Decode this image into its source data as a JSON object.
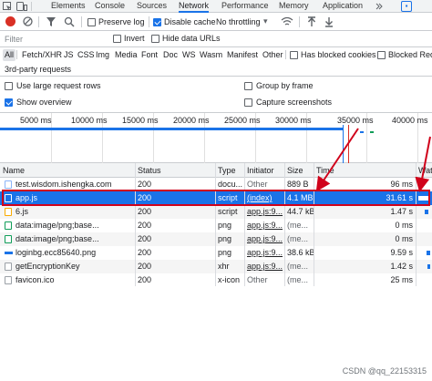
{
  "tabs": [
    "Elements",
    "Console",
    "Sources",
    "Network",
    "Performance",
    "Memory",
    "Application"
  ],
  "active_tab": "Network",
  "toolbar": {
    "preserve_log": "Preserve log",
    "disable_cache": "Disable cache",
    "throttling": "No throttling"
  },
  "filter": {
    "placeholder": "Filter",
    "invert": "Invert",
    "hide_data_urls": "Hide data URLs"
  },
  "types": [
    "All",
    "Fetch/XHR",
    "JS",
    "CSS",
    "Img",
    "Media",
    "Font",
    "Doc",
    "WS",
    "Wasm",
    "Manifest",
    "Other"
  ],
  "has_blocked_cookies": "Has blocked cookies",
  "blocked_requests": "Blocked Requ",
  "third_party": "3rd-party requests",
  "options": {
    "large_rows": "Use large request rows",
    "group_by_frame": "Group by frame",
    "show_overview": "Show overview",
    "capture_screenshots": "Capture screenshots"
  },
  "overview_ticks": [
    "5000 ms",
    "10000 ms",
    "15000 ms",
    "20000 ms",
    "25000 ms",
    "30000 ms",
    "35000 ms",
    "40000 ms"
  ],
  "table": {
    "headers": [
      "Name",
      "Status",
      "Type",
      "Initiator",
      "Size",
      "Time",
      "Wate"
    ],
    "rows": [
      {
        "name": "test.wisdom.ishengka.com",
        "status": "200",
        "type": "docu...",
        "initiator": "Other",
        "size": "889 B",
        "time": "96 ms"
      },
      {
        "name": "app.js",
        "status": "200",
        "type": "script",
        "initiator": "(index)",
        "size": "4.1 MB",
        "time": "31.61 s"
      },
      {
        "name": "6.js",
        "status": "200",
        "type": "script",
        "initiator": "app.js:9...",
        "size": "44.7 kB",
        "time": "1.47 s"
      },
      {
        "name": "data:image/png;base...",
        "status": "200",
        "type": "png",
        "initiator": "app.js:9...",
        "size": "(me...",
        "time": "0 ms"
      },
      {
        "name": "data:image/png;base...",
        "status": "200",
        "type": "png",
        "initiator": "app.js:9...",
        "size": "(me...",
        "time": "0 ms"
      },
      {
        "name": "loginbg.ecc85640.png",
        "status": "200",
        "type": "png",
        "initiator": "app.js:9...",
        "size": "38.6 kB",
        "time": "9.59 s"
      },
      {
        "name": "getEncryptionKey",
        "status": "200",
        "type": "xhr",
        "initiator": "app.js:9...",
        "size": "(me...",
        "time": "1.42 s"
      },
      {
        "name": "favicon.ico",
        "status": "200",
        "type": "x-icon",
        "initiator": "Other",
        "size": "(me...",
        "time": "25 ms"
      }
    ]
  },
  "watermark": "CSDN @qq_22153315",
  "colors": {
    "accent": "#1a73e8",
    "record_red": "#d93025",
    "annotation_red": "#d0021b"
  }
}
